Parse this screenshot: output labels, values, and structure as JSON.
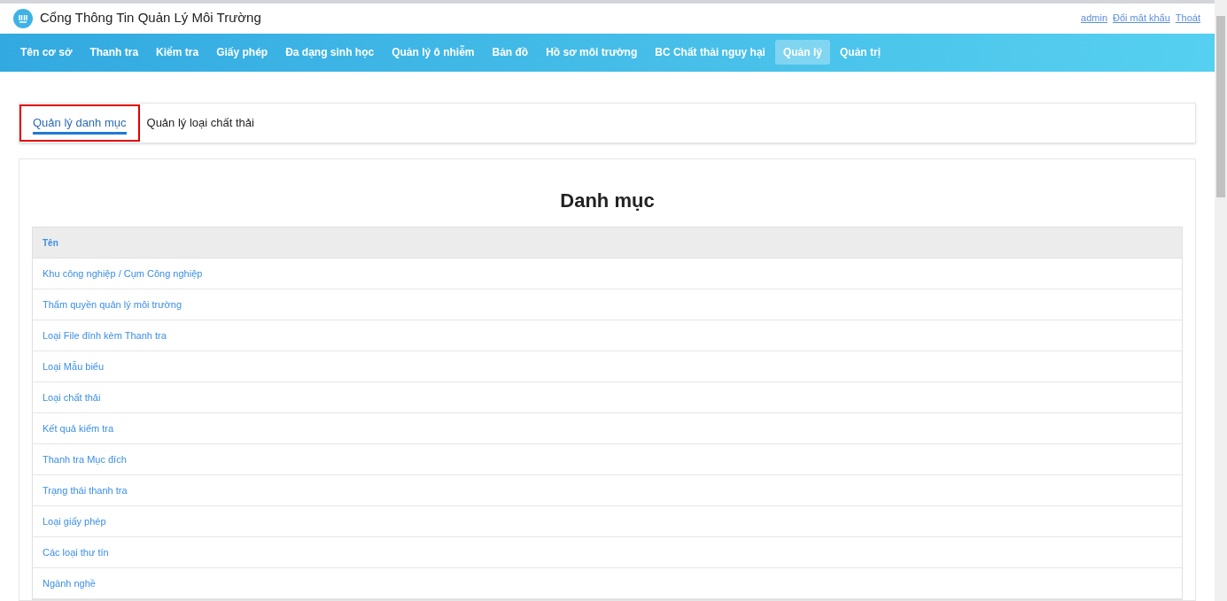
{
  "header": {
    "title": "Cổng Thông Tin Quản Lý Môi Trường",
    "user_links": [
      "admin",
      "Đổi mật khẩu",
      "Thoát"
    ]
  },
  "nav": [
    {
      "label": "Tên cơ sở",
      "selected": false
    },
    {
      "label": "Thanh tra",
      "selected": false
    },
    {
      "label": "Kiểm tra",
      "selected": false
    },
    {
      "label": "Giấy phép",
      "selected": false
    },
    {
      "label": "Đa dạng sinh học",
      "selected": false
    },
    {
      "label": "Quản lý ô nhiễm",
      "selected": false
    },
    {
      "label": "Bản đồ",
      "selected": false
    },
    {
      "label": "Hồ sơ môi trường",
      "selected": false
    },
    {
      "label": "BC Chất thải nguy hại",
      "selected": false
    },
    {
      "label": "Quản lý",
      "selected": true
    },
    {
      "label": "Quản trị",
      "selected": false
    }
  ],
  "tabs": [
    {
      "label": "Quản lý danh mục",
      "selected": true,
      "highlighted": true
    },
    {
      "label": "Quản lý loại chất thải",
      "selected": false,
      "highlighted": false
    }
  ],
  "panel": {
    "title": "Danh mục",
    "table": {
      "columns": [
        "Tên"
      ],
      "rows": [
        "Khu công nghiệp / Cụm Công nghiệp",
        "Thẩm quyền quản lý môi trường",
        "Loại File đính kèm Thanh tra",
        "Loại Mẫu biểu",
        "Loại chất thải",
        "Kết quả kiểm tra",
        "Thanh tra Mục đích",
        "Trạng thái thanh tra",
        "Loại giấy phép",
        "Các loại thư tín",
        "Ngành nghề"
      ]
    }
  }
}
